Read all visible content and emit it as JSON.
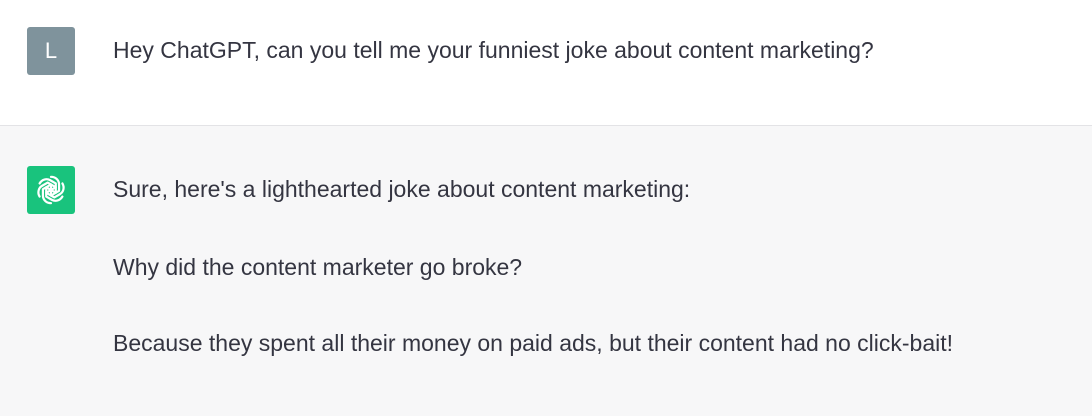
{
  "user_message": {
    "avatar_letter": "L",
    "avatar_color": "#7f939c",
    "text": "Hey ChatGPT, can you tell me your funniest joke about content marketing?"
  },
  "assistant_message": {
    "avatar_icon": "openai-logo-icon",
    "avatar_color": "#19c37d",
    "paragraphs": [
      "Sure, here's a lighthearted joke about content marketing:",
      "Why did the content marketer go broke?",
      "Because they spent all their money on paid ads, but their content had no click-bait!"
    ]
  }
}
